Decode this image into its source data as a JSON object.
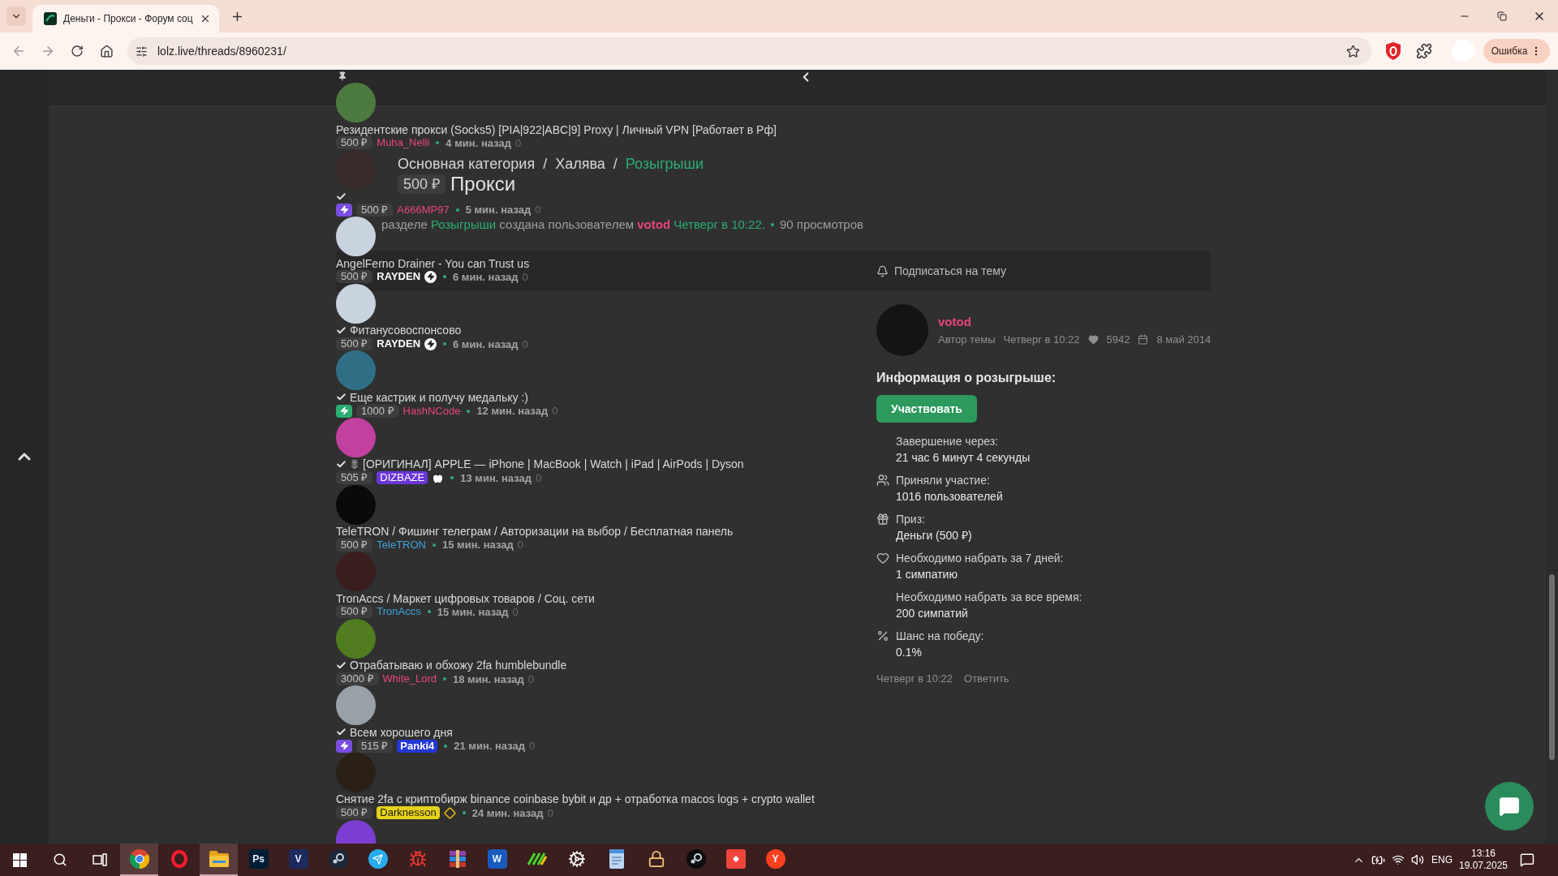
{
  "browser": {
    "tab": {
      "title": "Деньги - Прокси - Форум соц"
    },
    "address": "lolz.live/threads/8960231/",
    "profile_status": "Ошибка"
  },
  "page": {
    "threads": [
      {
        "kind": "thread",
        "title": "Резидентские прокси (Socks5) [PIA|922|ABC|9] Proxy | Личный VPN [Работает в Рф]",
        "checked": false,
        "price": "500 ₽",
        "author": {
          "name": "Muha_Nelli",
          "color": "#e8457f",
          "kind": "plain"
        },
        "time": "4 мин. назад",
        "replies": "0"
      },
      {
        "kind": "thread",
        "checked": true,
        "boost": {
          "color": "#7a4ee0"
        },
        "price": "500 ₽",
        "author": {
          "name": "A666MP97",
          "color": "#e8457f",
          "kind": "plain"
        },
        "time": "5 мин. назад",
        "replies": "0"
      },
      {
        "kind": "thread",
        "title": "AngelFerno Drainer - You can Trust us",
        "checked": false,
        "price": "500 ₽",
        "author": {
          "name": "RAYDEN",
          "color": "#ffffff",
          "kind": "bolt"
        },
        "time": "6 мин. назад",
        "replies": "0"
      },
      {
        "kind": "thread",
        "title": "Фитанусовоспонсово",
        "checked": true,
        "price": "500 ₽",
        "author": {
          "name": "RAYDEN",
          "color": "#ffffff",
          "kind": "bolt"
        },
        "time": "6 мин. назад",
        "replies": "0"
      },
      {
        "kind": "thread",
        "title": "Еще кастрик и получу медальку :)",
        "checked": true,
        "boost": {
          "color": "#2bad72"
        },
        "price": "1000 ₽",
        "author": {
          "name": "HashNCode",
          "color": "#e8457f",
          "kind": "plain"
        },
        "time": "12 мин. назад",
        "replies": "0"
      },
      {
        "kind": "thread",
        "title": "[ОРИГИНАЛ] APPLE — iPhone | MacBook | Watch | iPad | AirPods | Dyson",
        "checked": true,
        "emblem": true,
        "price": "505 ₽",
        "author": {
          "name": "DIZBAZE",
          "kind": "apple",
          "highlight": {
            "color": "#6b36d9"
          }
        },
        "time": "13 мин. назад",
        "replies": "0"
      },
      {
        "kind": "thread",
        "title": "TeleTRON / Фишинг телеграм / Авторизации на выбор / Бесплатная панель",
        "checked": false,
        "price": "500 ₽",
        "author": {
          "name": "TeleTRON",
          "color": "#3ea3dc",
          "kind": "plain"
        },
        "time": "15 мин. назад",
        "replies": "0"
      },
      {
        "kind": "thread",
        "title": "TronAccs / Маркет цифровых товаров / Соц. сети",
        "checked": false,
        "price": "500 ₽",
        "author": {
          "name": "TronAccs",
          "color": "#3ea3dc",
          "kind": "plain"
        },
        "time": "15 мин. назад",
        "replies": "0"
      },
      {
        "kind": "thread",
        "title": "Отрабатываю и обхожу 2fa humblebundle",
        "checked": true,
        "price": "3000 ₽",
        "author": {
          "name": "White_Lord",
          "color": "#e8457f",
          "kind": "plain"
        },
        "time": "18 мин. назад",
        "replies": "0"
      },
      {
        "kind": "thread",
        "title": "Всем хорошего дня",
        "checked": true,
        "boost": {
          "color": "#7a4ee0"
        },
        "price": "515 ₽",
        "author": {
          "name": "Panki4",
          "kind": "bold",
          "highlight": {
            "color": "#2438d8"
          }
        },
        "time": "21 мин. назад",
        "replies": "0"
      },
      {
        "kind": "thread",
        "title": "Снятие 2fa с криптобирж binance coinbase bybit и др + отработка macos logs + crypto wallet",
        "checked": false,
        "price": "500 ₽",
        "author": {
          "name": "Darknesson",
          "kind": "diamond",
          "highlight": {
            "color": "#e5d21a"
          }
        },
        "time": "24 мин. назад",
        "replies": "0"
      },
      {
        "kind": "partial"
      }
    ],
    "thread": {
      "breadcrumb": {
        "separator": "/",
        "items": [
          {
            "label": "Основная категория",
            "current": false
          },
          {
            "label": "Халява",
            "current": false
          },
          {
            "label": "Розыгрыши",
            "current": true
          }
        ]
      },
      "prefix": "500 ₽",
      "title": "Прокси",
      "info": [
        {
          "kind": "text",
          "text": "разделе "
        },
        {
          "kind": "section",
          "text": "Розыгрыши"
        },
        {
          "kind": "text",
          "text": " создана пользователем "
        },
        {
          "kind": "user",
          "text": "votod"
        },
        {
          "kind": "date",
          "text": "Четверг в 10:22"
        },
        {
          "kind": "text",
          "text": "."
        }
      ],
      "views": "90 просмотров",
      "subscribe": "Подписаться на тему",
      "post": {
        "author": "votod",
        "role": "Автор темы",
        "date": "Четверг в 10:22",
        "likes": "5942",
        "joined": "8 май 2014",
        "heading": "Информация о розыгрыше:",
        "join_button": "Участвовать",
        "facts": [
          {
            "kind": "plain",
            "label": "Завершение через:",
            "value": "21 час 6 минут 4 секунды"
          },
          {
            "kind": "users",
            "label": "Приняли участие:",
            "value": "1016 пользователей"
          },
          {
            "kind": "gift",
            "label": "Приз:",
            "value": "Деньги (500 ₽)"
          },
          {
            "kind": "like",
            "label": "Необходимо набрать за 7 дней:",
            "value": "1 симпатию"
          },
          {
            "kind": "plain",
            "label": "Необходимо набрать за все время:",
            "value": "200 симпатий"
          },
          {
            "kind": "chance",
            "label": "Шанс на победу:",
            "value": "0.1%"
          }
        ],
        "posted": "Четверг в 10:22",
        "reply": "Ответить"
      }
    }
  },
  "taskbar": {
    "apps": [
      {
        "kind": "orb",
        "active": true
      },
      {
        "kind": "ring",
        "active": false
      },
      {
        "kind": "folder",
        "active": true
      },
      {
        "kind": "letter",
        "label": "Ps",
        "color": "#001e36",
        "active": false
      },
      {
        "kind": "letter",
        "label": "V",
        "color": "#1d2b5c",
        "active": false
      },
      {
        "kind": "disc",
        "color": "#1b2838",
        "active": false
      },
      {
        "kind": "plane",
        "active": false
      },
      {
        "kind": "bug",
        "active": false
      },
      {
        "kind": "books",
        "active": false
      },
      {
        "kind": "letter",
        "label": "W",
        "color": "#185abd",
        "active": false
      },
      {
        "kind": "stripes",
        "active": false
      },
      {
        "kind": "gear",
        "active": false
      },
      {
        "kind": "note",
        "active": false
      },
      {
        "kind": "lock",
        "active": false
      },
      {
        "kind": "disc",
        "color": "#0d0d0d",
        "active": false
      },
      {
        "kind": "tile",
        "active": false
      },
      {
        "kind": "round_letter",
        "label": "Y",
        "color": "#fc3f1d",
        "active": false
      }
    ],
    "tray": {
      "language": "ENG",
      "time": "13:16",
      "date": "19.07.2025"
    }
  }
}
